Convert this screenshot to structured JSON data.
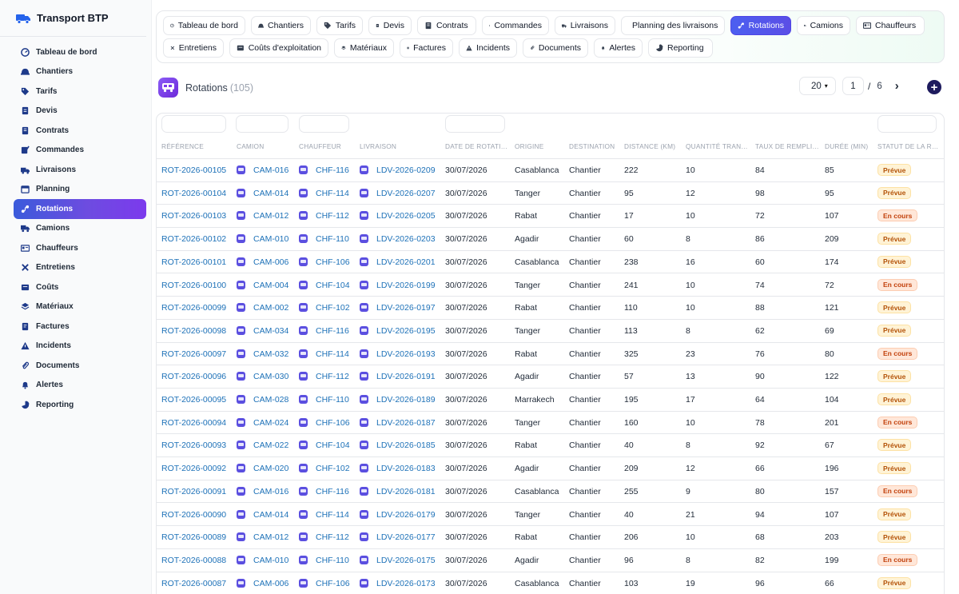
{
  "app": {
    "title": "Transport BTP"
  },
  "sidebar": {
    "items": [
      {
        "label": "Tableau de bord",
        "icon": "dashboard-icon"
      },
      {
        "label": "Chantiers",
        "icon": "helmet-icon"
      },
      {
        "label": "Tarifs",
        "icon": "tag-icon"
      },
      {
        "label": "Devis",
        "icon": "document-icon"
      },
      {
        "label": "Contrats",
        "icon": "contract-icon"
      },
      {
        "label": "Commandes",
        "icon": "order-icon"
      },
      {
        "label": "Livraisons",
        "icon": "delivery-icon"
      },
      {
        "label": "Planning",
        "icon": "calendar-icon"
      },
      {
        "label": "Rotations",
        "icon": "route-icon",
        "active": true
      },
      {
        "label": "Camions",
        "icon": "truck-icon"
      },
      {
        "label": "Chauffeurs",
        "icon": "id-card-icon"
      },
      {
        "label": "Entretiens",
        "icon": "wrench-icon"
      },
      {
        "label": "Coûts",
        "icon": "coins-icon"
      },
      {
        "label": "Matériaux",
        "icon": "material-icon"
      },
      {
        "label": "Factures",
        "icon": "invoice-icon"
      },
      {
        "label": "Incidents",
        "icon": "warning-icon"
      },
      {
        "label": "Documents",
        "icon": "attachment-icon"
      },
      {
        "label": "Alertes",
        "icon": "bell-icon"
      },
      {
        "label": "Reporting",
        "icon": "pie-chart-icon"
      }
    ]
  },
  "tabs": [
    {
      "label": "Tableau de bord",
      "icon": "dashboard-icon"
    },
    {
      "label": "Chantiers",
      "icon": "helmet-icon"
    },
    {
      "label": "Tarifs",
      "icon": "tag-icon"
    },
    {
      "label": "Devis",
      "icon": "document-icon"
    },
    {
      "label": "Contrats",
      "icon": "contract-icon"
    },
    {
      "label": "Commandes",
      "icon": "order-icon"
    },
    {
      "label": "Livraisons",
      "icon": "delivery-icon"
    },
    {
      "label": "Planning des livraisons",
      "icon": "calendar-icon"
    },
    {
      "label": "Rotations",
      "icon": "route-icon",
      "active": true
    },
    {
      "label": "Camions",
      "icon": "truck-icon"
    },
    {
      "label": "Chauffeurs",
      "icon": "id-card-icon"
    },
    {
      "label": "Entretiens",
      "icon": "wrench-icon"
    },
    {
      "label": "Coûts d'exploitation",
      "icon": "coins-icon"
    },
    {
      "label": "Matériaux",
      "icon": "material-icon"
    },
    {
      "label": "Factures",
      "icon": "invoice-icon"
    },
    {
      "label": "Incidents",
      "icon": "warning-icon"
    },
    {
      "label": "Documents",
      "icon": "attachment-icon"
    },
    {
      "label": "Alertes",
      "icon": "bell-icon"
    },
    {
      "label": "Reporting",
      "icon": "pie-chart-icon"
    }
  ],
  "page": {
    "title": "Rotations",
    "count": "(105)"
  },
  "pager": {
    "per_page": "20",
    "current": "1",
    "separator": "/",
    "total": "6",
    "next": "›",
    "add": "+"
  },
  "table": {
    "headers": [
      "RÉFÉRENCE",
      "CAMION",
      "CHAUFFEUR",
      "LIVRAISON",
      "DATE DE ROTATION",
      "ORIGINE",
      "DESTINATION",
      "DISTANCE (KM)",
      "QUANTITÉ TRANSPORTÉE",
      "TAUX DE REMPLISSAGE",
      "DURÉE (MIN)",
      "STATUT DE LA ROTATION"
    ],
    "rows": [
      [
        "ROT-2026-00105",
        "CAM-016",
        "CHF-116",
        "LDV-2026-0209",
        "30/07/2026",
        "Casablanca",
        "Chantier",
        "222",
        "10",
        "84",
        "85",
        "Prévue"
      ],
      [
        "ROT-2026-00104",
        "CAM-014",
        "CHF-114",
        "LDV-2026-0207",
        "30/07/2026",
        "Tanger",
        "Chantier",
        "95",
        "12",
        "98",
        "95",
        "Prévue"
      ],
      [
        "ROT-2026-00103",
        "CAM-012",
        "CHF-112",
        "LDV-2026-0205",
        "30/07/2026",
        "Rabat",
        "Chantier",
        "17",
        "10",
        "72",
        "107",
        "En cours"
      ],
      [
        "ROT-2026-00102",
        "CAM-010",
        "CHF-110",
        "LDV-2026-0203",
        "30/07/2026",
        "Agadir",
        "Chantier",
        "60",
        "8",
        "86",
        "209",
        "Prévue"
      ],
      [
        "ROT-2026-00101",
        "CAM-006",
        "CHF-106",
        "LDV-2026-0201",
        "30/07/2026",
        "Casablanca",
        "Chantier",
        "238",
        "16",
        "60",
        "174",
        "Prévue"
      ],
      [
        "ROT-2026-00100",
        "CAM-004",
        "CHF-104",
        "LDV-2026-0199",
        "30/07/2026",
        "Tanger",
        "Chantier",
        "241",
        "10",
        "74",
        "72",
        "En cours"
      ],
      [
        "ROT-2026-00099",
        "CAM-002",
        "CHF-102",
        "LDV-2026-0197",
        "30/07/2026",
        "Rabat",
        "Chantier",
        "110",
        "10",
        "88",
        "121",
        "Prévue"
      ],
      [
        "ROT-2026-00098",
        "CAM-034",
        "CHF-116",
        "LDV-2026-0195",
        "30/07/2026",
        "Tanger",
        "Chantier",
        "113",
        "8",
        "62",
        "69",
        "Prévue"
      ],
      [
        "ROT-2026-00097",
        "CAM-032",
        "CHF-114",
        "LDV-2026-0193",
        "30/07/2026",
        "Rabat",
        "Chantier",
        "325",
        "23",
        "76",
        "80",
        "En cours"
      ],
      [
        "ROT-2026-00096",
        "CAM-030",
        "CHF-112",
        "LDV-2026-0191",
        "30/07/2026",
        "Agadir",
        "Chantier",
        "57",
        "13",
        "90",
        "122",
        "Prévue"
      ],
      [
        "ROT-2026-00095",
        "CAM-028",
        "CHF-110",
        "LDV-2026-0189",
        "30/07/2026",
        "Marrakech",
        "Chantier",
        "195",
        "17",
        "64",
        "104",
        "Prévue"
      ],
      [
        "ROT-2026-00094",
        "CAM-024",
        "CHF-106",
        "LDV-2026-0187",
        "30/07/2026",
        "Tanger",
        "Chantier",
        "160",
        "10",
        "78",
        "201",
        "En cours"
      ],
      [
        "ROT-2026-00093",
        "CAM-022",
        "CHF-104",
        "LDV-2026-0185",
        "30/07/2026",
        "Rabat",
        "Chantier",
        "40",
        "8",
        "92",
        "67",
        "Prévue"
      ],
      [
        "ROT-2026-00092",
        "CAM-020",
        "CHF-102",
        "LDV-2026-0183",
        "30/07/2026",
        "Agadir",
        "Chantier",
        "209",
        "12",
        "66",
        "196",
        "Prévue"
      ],
      [
        "ROT-2026-00091",
        "CAM-016",
        "CHF-116",
        "LDV-2026-0181",
        "30/07/2026",
        "Casablanca",
        "Chantier",
        "255",
        "9",
        "80",
        "157",
        "En cours"
      ],
      [
        "ROT-2026-00090",
        "CAM-014",
        "CHF-114",
        "LDV-2026-0179",
        "30/07/2026",
        "Tanger",
        "Chantier",
        "40",
        "21",
        "94",
        "107",
        "Prévue"
      ],
      [
        "ROT-2026-00089",
        "CAM-012",
        "CHF-112",
        "LDV-2026-0177",
        "30/07/2026",
        "Rabat",
        "Chantier",
        "206",
        "10",
        "68",
        "203",
        "Prévue"
      ],
      [
        "ROT-2026-00088",
        "CAM-010",
        "CHF-110",
        "LDV-2026-0175",
        "30/07/2026",
        "Agadir",
        "Chantier",
        "96",
        "8",
        "82",
        "199",
        "En cours"
      ],
      [
        "ROT-2026-00087",
        "CAM-006",
        "CHF-106",
        "LDV-2026-0173",
        "30/07/2026",
        "Casablanca",
        "Chantier",
        "103",
        "19",
        "96",
        "66",
        "Prévue"
      ]
    ]
  },
  "colors": {
    "accent": "#4f46e5",
    "link": "#1d71b8",
    "status_prevue": "#b45309",
    "status_encours": "#c2410c"
  }
}
